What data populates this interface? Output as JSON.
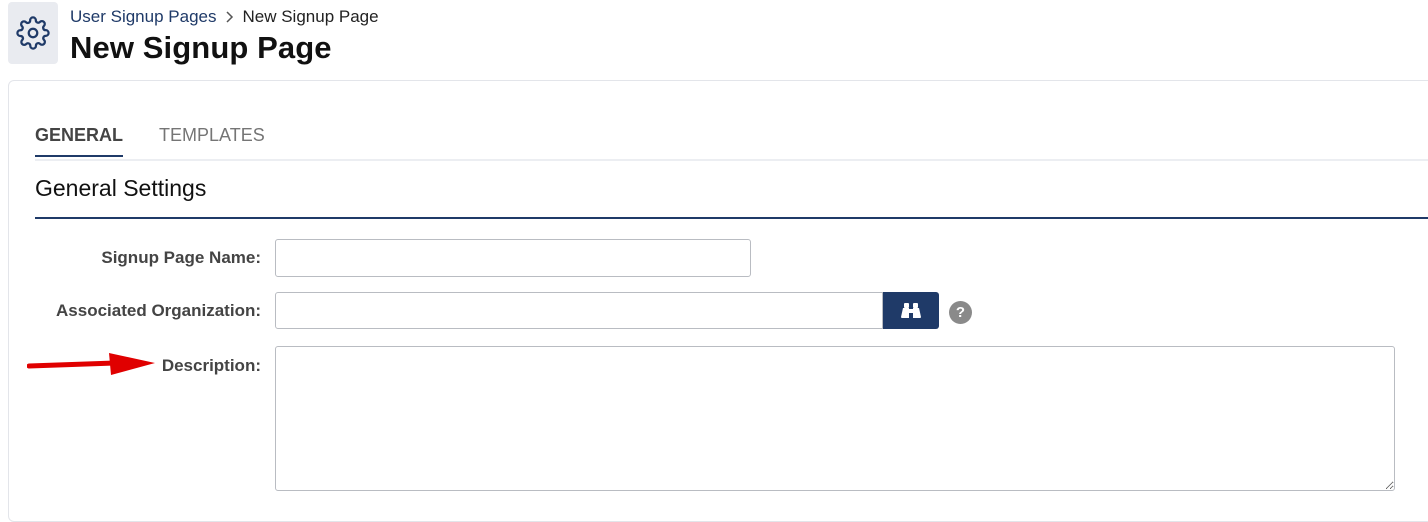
{
  "header": {
    "app_icon": "gear-icon",
    "breadcrumb": {
      "parent": "User Signup Pages",
      "separator_icon": "chevron-right-icon",
      "current": "New Signup Page"
    },
    "title": "New Signup Page"
  },
  "tabs": [
    {
      "label": "GENERAL",
      "active": true
    },
    {
      "label": "TEMPLATES",
      "active": false
    }
  ],
  "section": {
    "title": "General Settings"
  },
  "form": {
    "signup_page_name": {
      "label": "Signup Page Name:",
      "value": ""
    },
    "associated_organization": {
      "label": "Associated Organization:",
      "value": "",
      "lookup_icon": "binoculars-icon",
      "help_icon": "question-mark-icon",
      "help_text": "?"
    },
    "description": {
      "label": "Description:",
      "value": "",
      "annotation_icon": "red-arrow-icon"
    }
  },
  "colors": {
    "brand": "#1f3a68",
    "annotation_arrow": "#e00000",
    "help_icon": "#8a8a8a"
  }
}
